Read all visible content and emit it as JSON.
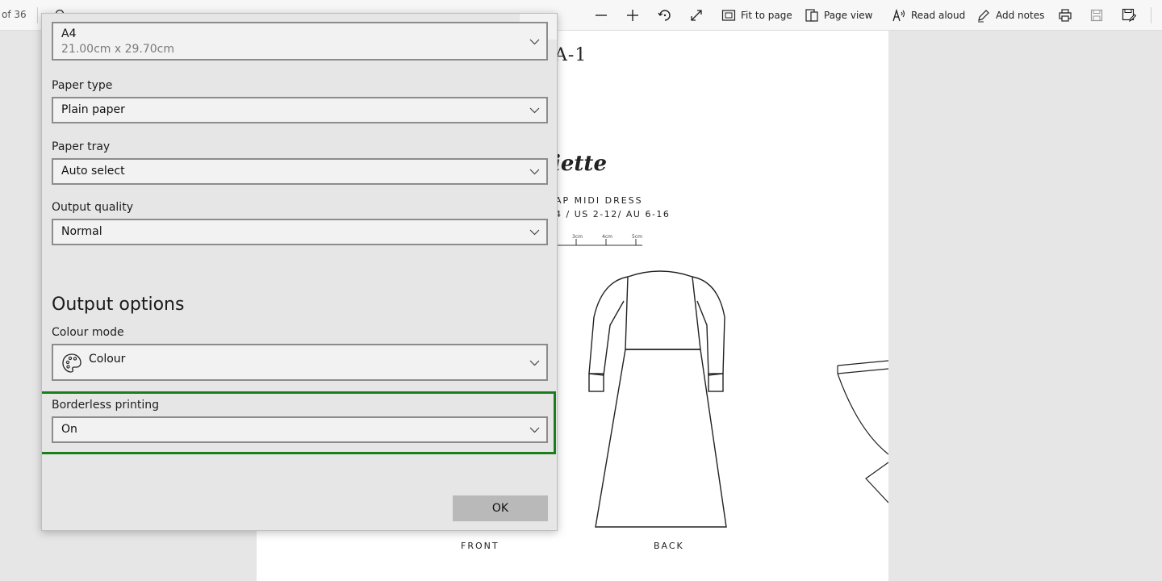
{
  "toolbar": {
    "page_count": "of 36",
    "fit_to_page": "Fit to page",
    "page_view": "Page view",
    "read_aloud": "Read aloud",
    "add_notes": "Add notes"
  },
  "document": {
    "code": "A-1",
    "brand": "iette",
    "title": "AP MIDI DRESS",
    "sizes": "4 / US 2-12/ AU 6-16",
    "ruler_labels": [
      "3cm",
      "4cm",
      "5cm"
    ],
    "front_label": "FRONT",
    "back_label": "BACK"
  },
  "dialog": {
    "paper_size": {
      "value": "A4",
      "dimensions": "21.00cm x 29.70cm"
    },
    "paper_type": {
      "label": "Paper type",
      "value": "Plain paper"
    },
    "paper_tray": {
      "label": "Paper tray",
      "value": "Auto select"
    },
    "output_quality": {
      "label": "Output quality",
      "value": "Normal"
    },
    "output_options_title": "Output options",
    "colour_mode": {
      "label": "Colour mode",
      "value": "Colour",
      "icon": "palette-icon"
    },
    "borderless": {
      "label": "Borderless printing",
      "value": "On"
    },
    "ok_label": "OK",
    "highlight_color": "#1a7f1a"
  }
}
